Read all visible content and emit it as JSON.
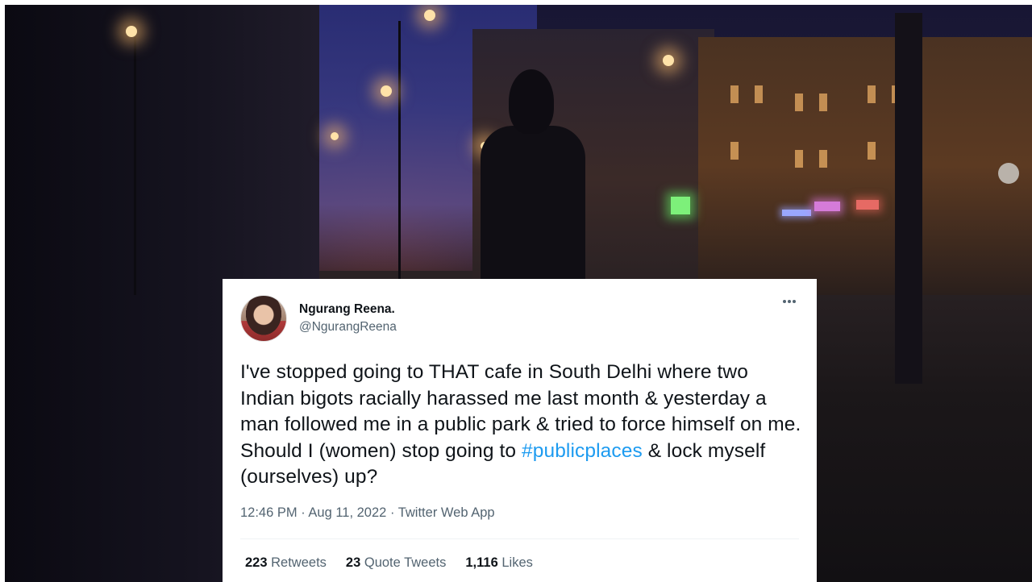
{
  "tweet": {
    "display_name": "Ngurang Reena.",
    "handle": "@NgurangReena",
    "text_before": "I've stopped going to THAT cafe in South Delhi where two Indian bigots racially harassed me last month & yesterday a man followed me in a public park & tried to force himself on me. Should I (women) stop going to ",
    "hashtag": "#publicplaces",
    "text_after": " & lock myself (ourselves) up?",
    "time": "12:46 PM",
    "date": "Aug 11, 2022",
    "source": "Twitter Web App",
    "retweets_count": "223",
    "retweets_label": "Retweets",
    "quote_tweets_count": "23",
    "quote_tweets_label": "Quote Tweets",
    "likes_count": "1,116",
    "likes_label": "Likes"
  },
  "colors": {
    "hashtag": "#1d9bf0",
    "secondary_text": "#536471",
    "primary_text": "#0f1419"
  },
  "icons": {
    "more": "more-horizontal-icon"
  }
}
